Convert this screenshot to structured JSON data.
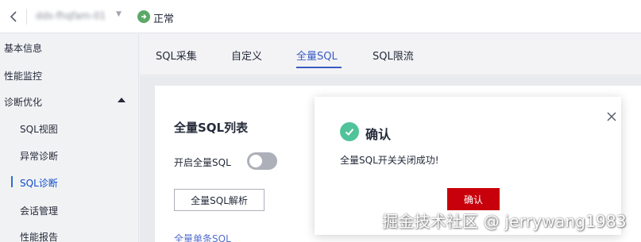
{
  "header": {
    "instance_name": "dds-fhqfam-01",
    "status_label": "正常"
  },
  "sidebar": {
    "items": [
      {
        "label": "基本信息"
      },
      {
        "label": "性能监控"
      },
      {
        "label": "诊断优化"
      }
    ],
    "sub_items": [
      {
        "label": "SQL视图"
      },
      {
        "label": "异常诊断"
      },
      {
        "label": "SQL诊断"
      },
      {
        "label": "会话管理"
      },
      {
        "label": "性能报告"
      }
    ]
  },
  "tabs": [
    {
      "label": "SQL采集"
    },
    {
      "label": "自定义"
    },
    {
      "label": "全量SQL"
    },
    {
      "label": "SQL限流"
    }
  ],
  "card": {
    "title": "全量SQL列表",
    "toggle_label": "开启全量SQL",
    "analyze_button": "全量SQL解析",
    "partial_link": "全量单条SQL"
  },
  "modal": {
    "title": "确认",
    "message": "全量SQL开关关闭成功!",
    "ok_button": "确认"
  },
  "watermark": "掘金技术社区 @ jerrywang1983",
  "colors": {
    "status_green": "#5ca868",
    "success_icon": "#50c39b",
    "primary_red": "#c7000b",
    "active_tab": "#3a5cc4",
    "active_sidebar": "#0e4cc7"
  }
}
